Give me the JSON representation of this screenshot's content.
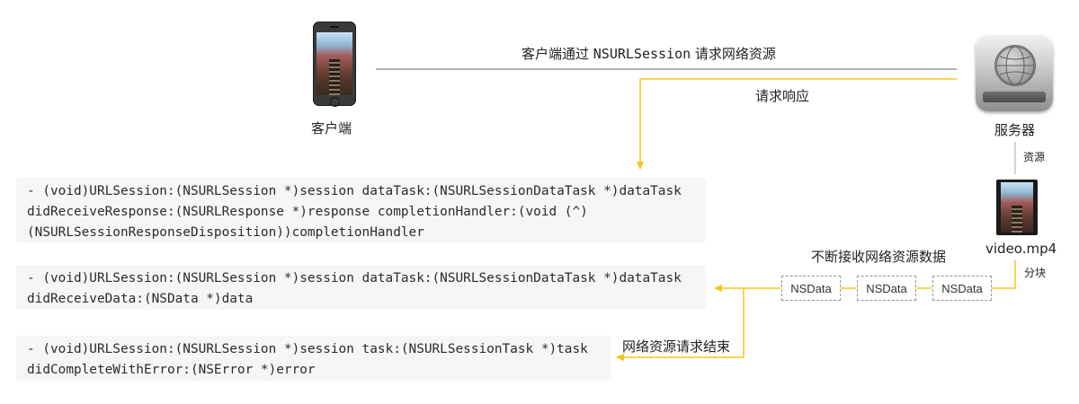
{
  "client": {
    "label": "客户端",
    "icon": "phone-icon"
  },
  "server": {
    "label": "服务器",
    "icon": "server-icon"
  },
  "request": {
    "prefix": "客户端通过 ",
    "code": "NSURLSession",
    "suffix": " 请求网络资源"
  },
  "response_label": "请求响应",
  "resource_label": "资源",
  "video": {
    "filename": "video.mp4",
    "icon": "video-thumbnail-icon"
  },
  "chunk_label": "分块",
  "receive_label": "不断接收网络资源数据",
  "chunks": [
    "NSData",
    "NSData",
    "NSData"
  ],
  "complete_label": "网络资源请求结束",
  "callbacks": [
    {
      "lines": [
        "- (void)URLSession:(NSURLSession *)session dataTask:(NSURLSessionDataTask *)dataTask",
        "didReceiveResponse:(NSURLResponse *)response completionHandler:(void (^)",
        "(NSURLSessionResponseDisposition))completionHandler"
      ]
    },
    {
      "lines": [
        "- (void)URLSession:(NSURLSession *)session dataTask:(NSURLSessionDataTask *)dataTask",
        "didReceiveData:(NSData *)data"
      ]
    },
    {
      "lines": [
        "- (void)URLSession:(NSURLSession *)session task:(NSURLSessionTask *)task",
        "didCompleteWithError:(NSError *)error"
      ]
    }
  ],
  "colors": {
    "arrow": "#f5c518",
    "request_line": "#999999",
    "code_bg": "#f6f6f6"
  }
}
